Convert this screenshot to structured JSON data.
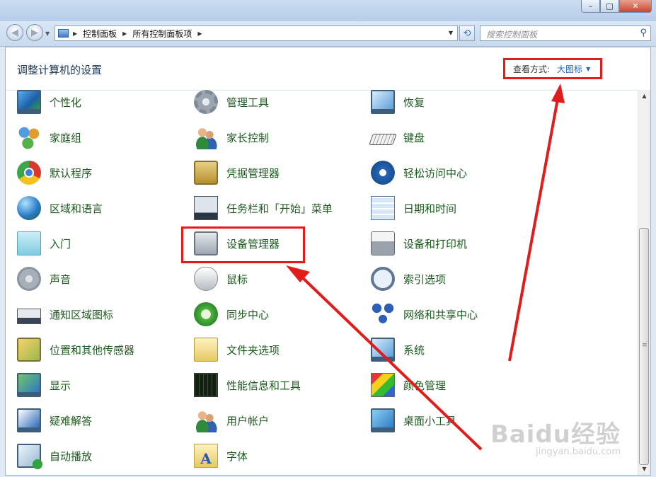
{
  "window": {
    "minimize": "–",
    "maximize": "□",
    "close": "✕"
  },
  "nav": {
    "back": "◀",
    "forward": "▶",
    "breadcrumb": [
      "控制面板",
      "所有控制面板项"
    ],
    "search_placeholder": "搜索控制面板"
  },
  "header": {
    "title": "调整计算机的设置",
    "view_by_label": "查看方式:",
    "view_by_value": "大图标"
  },
  "items": [
    {
      "label": "个性化",
      "icon": "personalization-icon"
    },
    {
      "label": "管理工具",
      "icon": "admin-tools-icon"
    },
    {
      "label": "恢复",
      "icon": "recovery-icon"
    },
    {
      "label": "家庭组",
      "icon": "homegroup-icon"
    },
    {
      "label": "家长控制",
      "icon": "parental-controls-icon"
    },
    {
      "label": "键盘",
      "icon": "keyboard-icon"
    },
    {
      "label": "默认程序",
      "icon": "default-programs-icon"
    },
    {
      "label": "凭据管理器",
      "icon": "credential-manager-icon"
    },
    {
      "label": "轻松访问中心",
      "icon": "ease-of-access-icon"
    },
    {
      "label": "区域和语言",
      "icon": "region-language-icon"
    },
    {
      "label": "任务栏和「开始」菜单",
      "icon": "taskbar-icon"
    },
    {
      "label": "日期和时间",
      "icon": "date-time-icon"
    },
    {
      "label": "入门",
      "icon": "getting-started-icon"
    },
    {
      "label": "设备管理器",
      "icon": "device-manager-icon"
    },
    {
      "label": "设备和打印机",
      "icon": "devices-printers-icon"
    },
    {
      "label": "声音",
      "icon": "sound-icon"
    },
    {
      "label": "鼠标",
      "icon": "mouse-icon"
    },
    {
      "label": "索引选项",
      "icon": "indexing-icon"
    },
    {
      "label": "通知区域图标",
      "icon": "notification-area-icon"
    },
    {
      "label": "同步中心",
      "icon": "sync-center-icon"
    },
    {
      "label": "网络和共享中心",
      "icon": "network-center-icon"
    },
    {
      "label": "位置和其他传感器",
      "icon": "location-sensors-icon"
    },
    {
      "label": "文件夹选项",
      "icon": "folder-options-icon"
    },
    {
      "label": "系统",
      "icon": "system-icon"
    },
    {
      "label": "显示",
      "icon": "display-icon"
    },
    {
      "label": "性能信息和工具",
      "icon": "performance-icon"
    },
    {
      "label": "颜色管理",
      "icon": "color-management-icon"
    },
    {
      "label": "疑难解答",
      "icon": "troubleshooting-icon"
    },
    {
      "label": "用户帐户",
      "icon": "user-accounts-icon"
    },
    {
      "label": "桌面小工具",
      "icon": "desktop-gadgets-icon"
    },
    {
      "label": "自动播放",
      "icon": "autoplay-icon"
    },
    {
      "label": "字体",
      "icon": "fonts-icon"
    }
  ],
  "watermark": {
    "brand": "Baidu经验",
    "url": "jingyan.baidu.com"
  },
  "colors": {
    "annotation": "#e21b1b",
    "link_green": "#1c5a1e",
    "link_blue": "#1a65c4"
  }
}
